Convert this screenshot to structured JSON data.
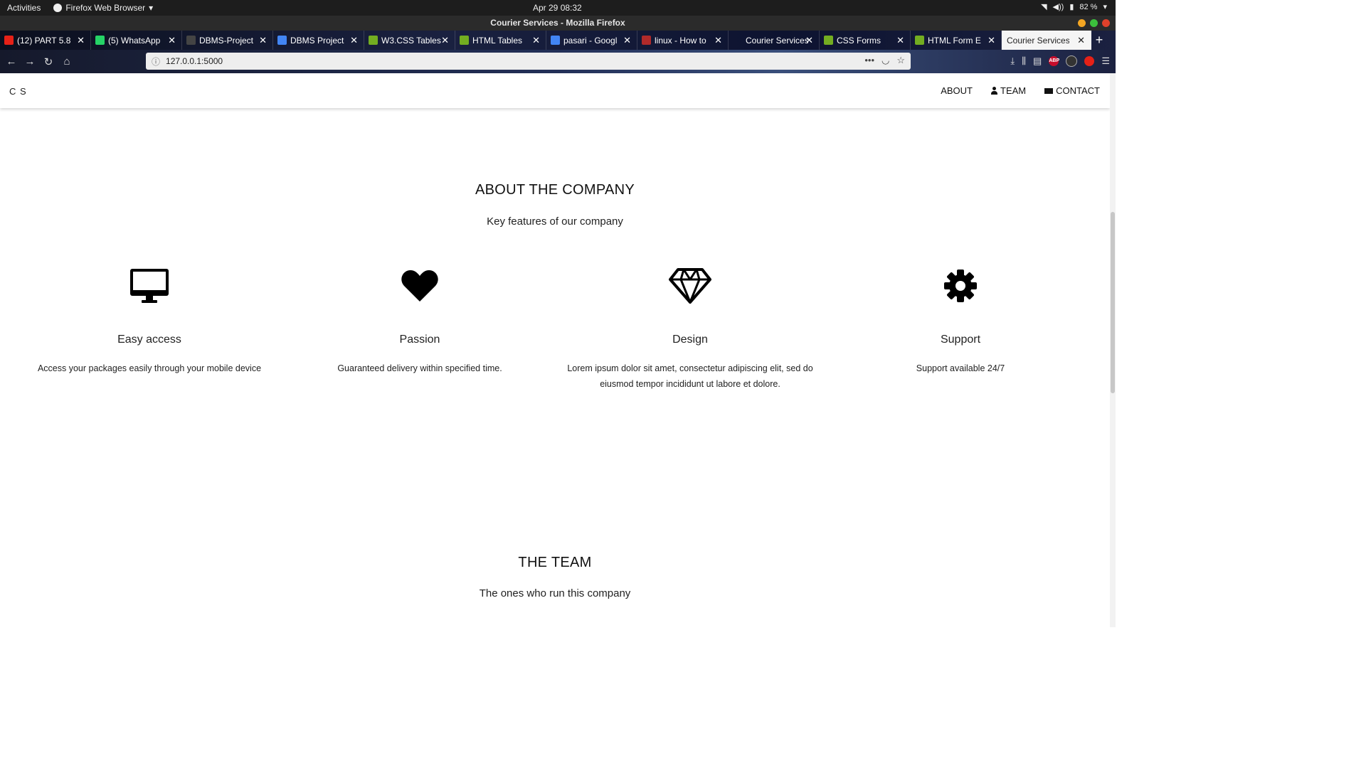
{
  "system_bar": {
    "activities": "Activities",
    "app_menu": "Firefox Web Browser",
    "clock": "Apr 29  08:32",
    "battery": "82 %"
  },
  "window": {
    "title": "Courier Services - Mozilla Firefox"
  },
  "tabs": [
    {
      "label": "(12) PART 5.8",
      "favicon_color": "#e62117"
    },
    {
      "label": "(5) WhatsApp",
      "favicon_color": "#25d366"
    },
    {
      "label": "DBMS-Project",
      "favicon_color": "#444444"
    },
    {
      "label": "DBMS Project",
      "favicon_color": "#4285f4"
    },
    {
      "label": "W3.CSS Tables",
      "favicon_color": "#73ad21"
    },
    {
      "label": "HTML Tables",
      "favicon_color": "#73ad21"
    },
    {
      "label": "pasari - Googl",
      "favicon_color": "#4285f4"
    },
    {
      "label": "linux - How to",
      "favicon_color": "#b02a2a"
    },
    {
      "label": "Courier Services",
      "favicon_color": ""
    },
    {
      "label": "CSS Forms",
      "favicon_color": "#73ad21"
    },
    {
      "label": "HTML Form E",
      "favicon_color": "#73ad21"
    },
    {
      "label": "Courier Services",
      "favicon_color": "",
      "active": true
    }
  ],
  "toolbar": {
    "url": "127.0.0.1:5000",
    "abp": "ABP"
  },
  "site": {
    "brand": "C S",
    "nav": {
      "about": "ABOUT",
      "team": "TEAM",
      "contact": "CONTACT"
    },
    "about": {
      "title": "ABOUT THE COMPANY",
      "subtitle": "Key features of our company",
      "features": [
        {
          "icon": "desktop-icon",
          "title": "Easy access",
          "desc": "Access your packages easily through your mobile device"
        },
        {
          "icon": "heart-icon",
          "title": "Passion",
          "desc": "Guaranteed delivery within specified time."
        },
        {
          "icon": "diamond-icon",
          "title": "Design",
          "desc": "Lorem ipsum dolor sit amet, consectetur adipiscing elit, sed do eiusmod tempor incididunt ut labore et dolore."
        },
        {
          "icon": "gear-icon",
          "title": "Support",
          "desc": "Support available 24/7"
        }
      ]
    },
    "team": {
      "title": "THE TEAM",
      "subtitle": "The ones who run this company"
    }
  }
}
